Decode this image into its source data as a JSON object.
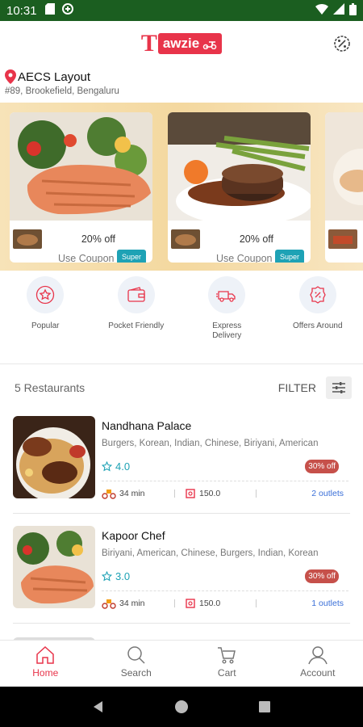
{
  "status": {
    "time": "10:31"
  },
  "app": {
    "logo_letter": "T",
    "logo_text": "awzie"
  },
  "location": {
    "title": "AECS Layout",
    "address": "#89, Brookefield, Bengaluru"
  },
  "banners": [
    {
      "offer": "20% off",
      "coupon_label": "Use Coupon",
      "badge": "Super"
    },
    {
      "offer": "20% off",
      "coupon_label": "Use Coupon",
      "badge": "Super"
    }
  ],
  "categories": [
    {
      "label": "Popular",
      "icon": "star-icon"
    },
    {
      "label": "Pocket Friendly",
      "icon": "wallet-icon"
    },
    {
      "label": "Express Delivery",
      "icon": "truck-icon"
    },
    {
      "label": "Offers Around",
      "icon": "percent-tag-icon"
    }
  ],
  "list": {
    "count_label": "5 Restaurants",
    "filter_label": "FILTER"
  },
  "restaurants": [
    {
      "name": "Nandhana Palace",
      "cuisines": "Burgers, Korean, Indian, Chinese, Biriyani, American",
      "rating": "4.0",
      "discount": "30% off",
      "time": "34 min",
      "price": "150.0",
      "outlets": "2 outlets"
    },
    {
      "name": "Kapoor Chef",
      "cuisines": "Biriyani, American, Chinese, Burgers, Indian, Korean",
      "rating": "3.0",
      "discount": "30% off",
      "time": "34 min",
      "price": "150.0",
      "outlets": "1 outlets"
    }
  ],
  "nav": [
    {
      "label": "Home"
    },
    {
      "label": "Search"
    },
    {
      "label": "Cart"
    },
    {
      "label": "Account"
    }
  ],
  "colors": {
    "brand": "#e8344a",
    "accent": "#1ea2b5",
    "statusbar": "#1b5e20",
    "discount": "#c6504a",
    "link": "#3a6fd8"
  }
}
